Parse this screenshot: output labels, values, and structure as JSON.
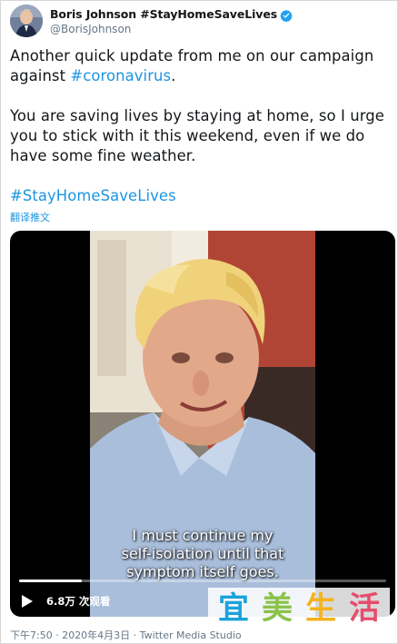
{
  "author": {
    "display_name": "Boris Johnson #StayHomeSaveLives",
    "handle": "@BorisJohnson",
    "verified_icon": "verified-badge-icon",
    "avatar_icon": "avatar-photo"
  },
  "tweet": {
    "line1": "Another quick update from me on our campaign",
    "line2_prefix": "against ",
    "line2_hashtag": "#coronavirus",
    "line2_suffix": ".",
    "para2_line1": "You are saving lives by staying at home, so I urge",
    "para2_line2": "you to stick with it this weekend, even if we do",
    "para2_line3": "have some fine weather.",
    "hashtag_line": "#StayHomeSaveLives",
    "translate_label": "翻译推文"
  },
  "video": {
    "subtitle_line1": "I must continue my",
    "subtitle_line2": "self-isolation until that",
    "subtitle_line3": "symptom itself goes.",
    "views": "6.8万 次观看",
    "progress": 0.17,
    "play_icon": "play-icon"
  },
  "watermark": {
    "chars": [
      "宜",
      "美",
      "生",
      "活"
    ]
  },
  "footer": {
    "meta": "下午7:50 · 2020年4月3日 · Twitter Media Studio"
  },
  "colors": {
    "link": "#1b95e0",
    "secondary_text": "#657786",
    "primary_text": "#14171a",
    "video_bg": "#000000"
  }
}
